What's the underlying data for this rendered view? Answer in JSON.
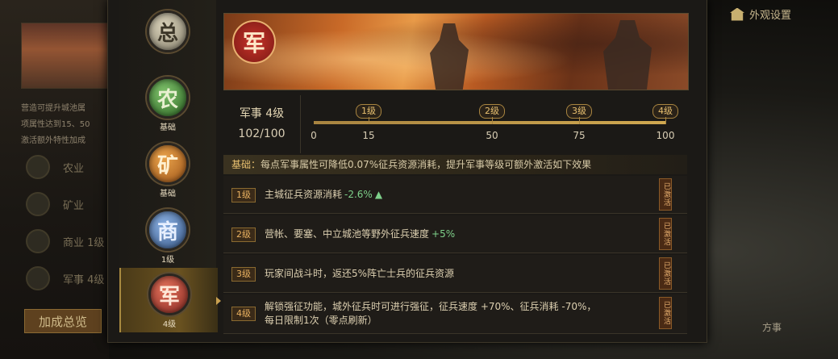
{
  "background": {
    "left_text_line1": "营造可提升城池属",
    "left_text_line2": "项属性达到15、50",
    "left_text_line3": "激活额外特性加成",
    "rows": [
      {
        "label": "农业"
      },
      {
        "label": "矿业"
      },
      {
        "label": "商业  1级"
      },
      {
        "label": "军事  4级"
      }
    ],
    "bonus_button": "加成总览",
    "top_right_label": "外观设置",
    "bottom_right_label": "方事"
  },
  "tabs": [
    {
      "glyph": "总",
      "level": ""
    },
    {
      "glyph": "农",
      "level": "基础"
    },
    {
      "glyph": "矿",
      "level": "基础"
    },
    {
      "glyph": "商",
      "level": "1级"
    },
    {
      "glyph": "军",
      "level": "4级"
    }
  ],
  "banner": {
    "glyph": "军"
  },
  "level_info": {
    "name": "军事  4级",
    "progress": "102/100"
  },
  "progress_track": {
    "current": 102,
    "max": 100,
    "start_label": "0",
    "milestones": [
      {
        "label": "1级",
        "value": "15"
      },
      {
        "label": "2级",
        "value": "50"
      },
      {
        "label": "3级",
        "value": "75"
      },
      {
        "label": "4级",
        "value": "100"
      }
    ]
  },
  "base_effect": {
    "tag": "基础：",
    "text": "每点军事属性可降低0.07%征兵资源消耗，提升军事等级可额外激活如下效果"
  },
  "effects": [
    {
      "level": "1级",
      "text": "主城征兵资源消耗",
      "highlight": "-2.6%",
      "extra": "",
      "state": "已激活"
    },
    {
      "level": "2级",
      "text": "营帐、要塞、中立城池等野外征兵速度",
      "highlight": "+5%",
      "extra": "",
      "state": "已激活"
    },
    {
      "level": "3级",
      "text": "玩家间战斗时，返还5%阵亡士兵的征兵资源",
      "highlight": "",
      "extra": "",
      "state": "已激活"
    },
    {
      "level": "4级",
      "text": "解锁强征功能，城外征兵时可进行强征，征兵速度 +70%、征兵消耗 -70%，",
      "highlight": "",
      "extra": "每日限制1次（零点刷新）",
      "state": "已激活"
    }
  ],
  "colors": {
    "accent_gold": "#e8c070",
    "positive_green": "#7ed08a",
    "active_tab": "#6a5220"
  }
}
